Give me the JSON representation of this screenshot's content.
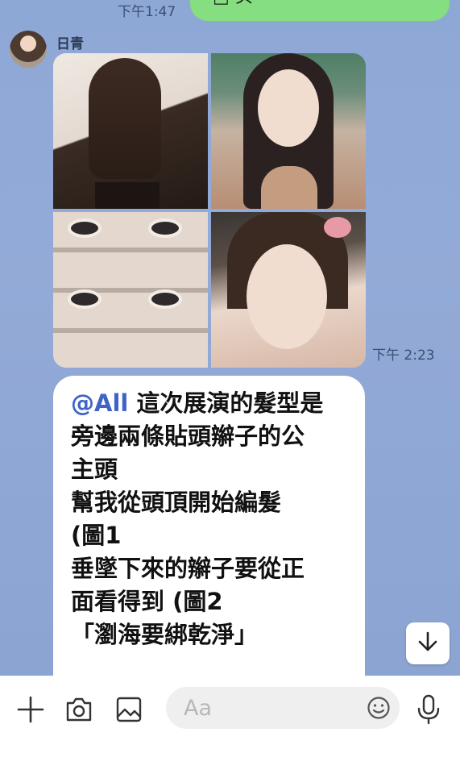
{
  "previous_message": {
    "time": "下午1:47",
    "fragment": "□ 头"
  },
  "sender": {
    "name": "日青"
  },
  "photo_message": {
    "time": "下午 2:23",
    "photo_count": 4
  },
  "text_message": {
    "mention": "@All",
    "body": " 這次展演的髮型是\n旁邊兩條貼頭辮子的公\n主頭\n幫我從頭頂開始編髮\n(圖1\n垂墜下來的辮子要從正\n面看得到 (圖2\n「瀏海要綁乾淨」"
  },
  "input_bar": {
    "placeholder": "Aa",
    "icons": [
      "plus-icon",
      "camera-icon",
      "image-icon",
      "emoji-icon",
      "microphone-icon"
    ]
  },
  "scroll_button": {
    "icon": "arrow-down-icon"
  },
  "colors": {
    "chat_background": "#8ea8d6",
    "outgoing_bubble": "#85de7f",
    "incoming_bubble": "#ffffff",
    "mention": "#3f63c6"
  }
}
